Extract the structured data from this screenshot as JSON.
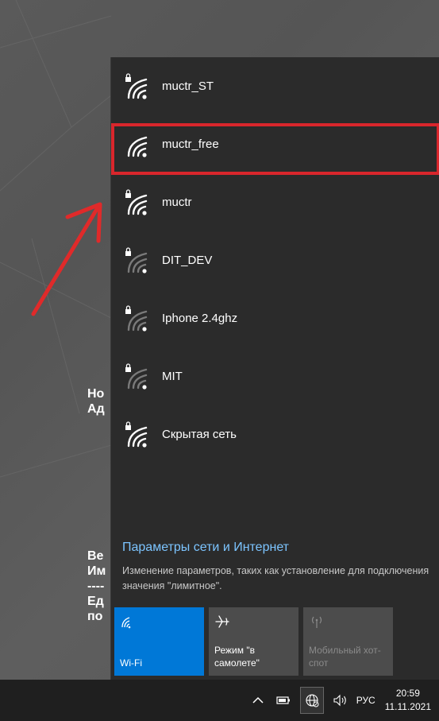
{
  "networks": [
    {
      "name": "muctr_ST",
      "secured": true,
      "signal": "full"
    },
    {
      "name": "muctr_free",
      "secured": false,
      "signal": "full"
    },
    {
      "name": "muctr",
      "secured": true,
      "signal": "full"
    },
    {
      "name": "DIT_DEV",
      "secured": true,
      "signal": "low"
    },
    {
      "name": "Iphone 2.4ghz",
      "secured": true,
      "signal": "low"
    },
    {
      "name": "MIT",
      "secured": true,
      "signal": "low"
    },
    {
      "name": "Скрытая сеть",
      "secured": true,
      "signal": "full"
    }
  ],
  "settings": {
    "link": "Параметры сети и Интернет",
    "description": "Изменение параметров, таких как установление для подключения значения \"лимитное\"."
  },
  "tiles": [
    {
      "label": "Wi-Fi",
      "icon": "wifi-icon",
      "state": "active"
    },
    {
      "label": "Режим \"в самолете\"",
      "icon": "airplane-icon",
      "state": "off"
    },
    {
      "label": "Мобильный хот-спот",
      "icon": "hotspot-icon",
      "state": "disabled"
    }
  ],
  "desktop_text": {
    "block1": [
      "Но",
      "Ад"
    ],
    "block2": [
      "Ве",
      "Им",
      "----",
      "Ед",
      "по"
    ]
  },
  "taskbar": {
    "language": "РУС",
    "time": "20:59",
    "date": "11.11.2021"
  },
  "colors": {
    "accent": "#0078d7",
    "highlight": "#d9262c",
    "link": "#7cc4ff"
  }
}
